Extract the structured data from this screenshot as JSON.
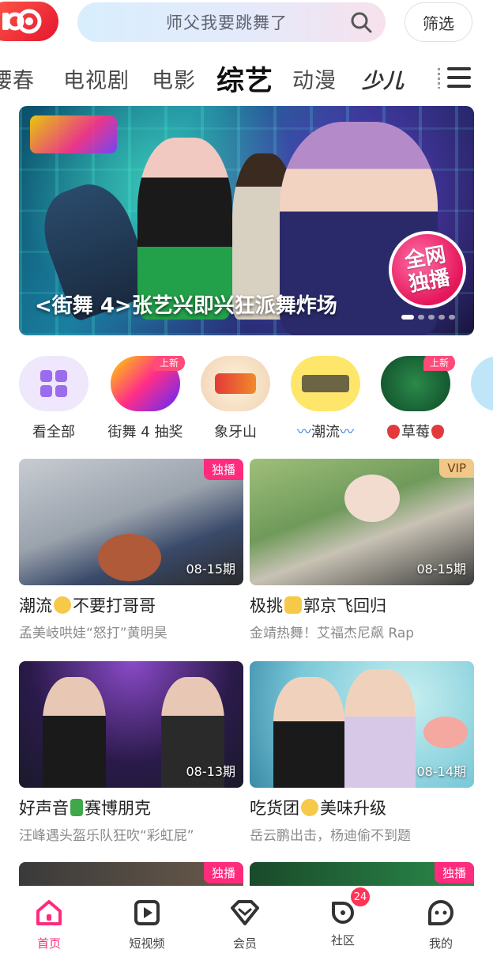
{
  "search": {
    "placeholder": "师父我要跳舞了",
    "filter_label": "筛选"
  },
  "tabs": [
    {
      "label": "䁏春"
    },
    {
      "label": "电视剧"
    },
    {
      "label": "电影"
    },
    {
      "label": "综艺",
      "active": true
    },
    {
      "label": "动漫"
    },
    {
      "label": "少儿"
    }
  ],
  "banner": {
    "caption": "<街舞 4>张艺兴即兴狂派舞炸场",
    "badge_line1": "全网",
    "badge_line2": "独播",
    "active_dot": 0,
    "dot_count": 5
  },
  "shortcuts": [
    {
      "label": "看全部",
      "new": false
    },
    {
      "label": "街舞 4 抽奖",
      "new": true,
      "new_label": "上新"
    },
    {
      "label": "象牙山",
      "new": false
    },
    {
      "label": "潮流",
      "new": false
    },
    {
      "label": "草莓",
      "new": true,
      "new_label": "上新"
    }
  ],
  "cards": [
    {
      "title_a": "潮流",
      "title_b": "不要打哥哥",
      "subtitle": "孟美岐哄娃“怒打”黄明昊",
      "episode": "08-15期",
      "badge": "独播",
      "badge_type": "excl"
    },
    {
      "title_a": "极挑",
      "title_b": "郭京飞回归",
      "subtitle": "金靖热舞！艾福杰尼飙 Rap",
      "episode": "08-15期",
      "badge": "VIP",
      "badge_type": "vip"
    },
    {
      "title_a": "好声音",
      "title_b": "赛博朋克",
      "subtitle": "汪峰遇头盔乐队狂吹“彩虹屁”",
      "episode": "08-13期",
      "badge": "",
      "badge_type": ""
    },
    {
      "title_a": "吃货团",
      "title_b": "美味升级",
      "subtitle": "岳云鹏出击，杨迪偷不到题",
      "episode": "08-14期",
      "badge": "",
      "badge_type": ""
    },
    {
      "badge": "独播",
      "badge_type": "excl"
    },
    {
      "badge": "独播",
      "badge_type": "excl"
    }
  ],
  "bottom_nav": [
    {
      "label": "首页",
      "active": true,
      "icon": "home-icon"
    },
    {
      "label": "短视频",
      "icon": "play-icon"
    },
    {
      "label": "会员",
      "icon": "diamond-icon"
    },
    {
      "label": "社区",
      "icon": "community-icon",
      "badge": "24"
    },
    {
      "label": "我的",
      "icon": "profile-icon"
    }
  ],
  "colors": {
    "accent": "#ff2b7d",
    "vip": "#f2c888",
    "shortcut_purple": "#9b6bf0"
  }
}
